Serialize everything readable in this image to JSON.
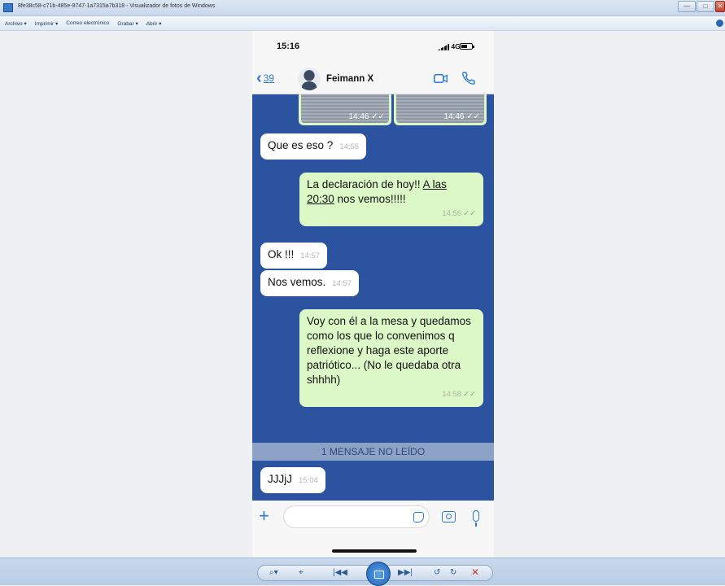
{
  "window": {
    "title": "8fe38c58-c71b-485e-9747-1a7315a7b318 - Visualizador de fotos de Windows",
    "buttons": {
      "minimize": "—",
      "maximize": "□",
      "close": "✕"
    }
  },
  "menubar": {
    "items": [
      "Archivo ▾",
      "Imprimir ▾",
      "Correo electrónico",
      "Grabar ▾",
      "Abrir ▾"
    ]
  },
  "phone": {
    "status": {
      "time": "15:16",
      "network": "4G"
    },
    "header": {
      "back_count": "39",
      "contact_name": "Feimann X"
    },
    "images": [
      {
        "time": "14:46 ✓✓"
      },
      {
        "time": "14:46 ✓✓"
      }
    ],
    "messages": [
      {
        "dir": "in",
        "text": "Que es eso ?",
        "time": "14:55"
      },
      {
        "dir": "out",
        "text_before": "La declaración de hoy!! ",
        "text_link": "A las 20:30",
        "text_after": " nos vemos!!!!!",
        "time": "14:56"
      },
      {
        "dir": "in",
        "text": "Ok !!!",
        "time": "14:57"
      },
      {
        "dir": "in",
        "text": "Nos vemos.",
        "time": "14:57"
      },
      {
        "dir": "out",
        "text": "Voy con él a la mesa y quedamos como los que lo convenimos q reflexione y haga este aporte patriótico... (No le quedaba otra shhhh)",
        "time": "14:58"
      },
      {
        "dir": "in",
        "text": "JJJjJ",
        "time": "15:04"
      }
    ],
    "unread_banner": "1 MENSAJE NO LEÍDO",
    "input": {
      "plus": "+"
    }
  },
  "toolbar": {
    "zoom": "⌕▾",
    "fit": "⌖",
    "prev": "|◀◀",
    "next": "▶▶|",
    "rotate_ccw": "↺",
    "rotate_cw": "↻",
    "delete": "✕"
  }
}
